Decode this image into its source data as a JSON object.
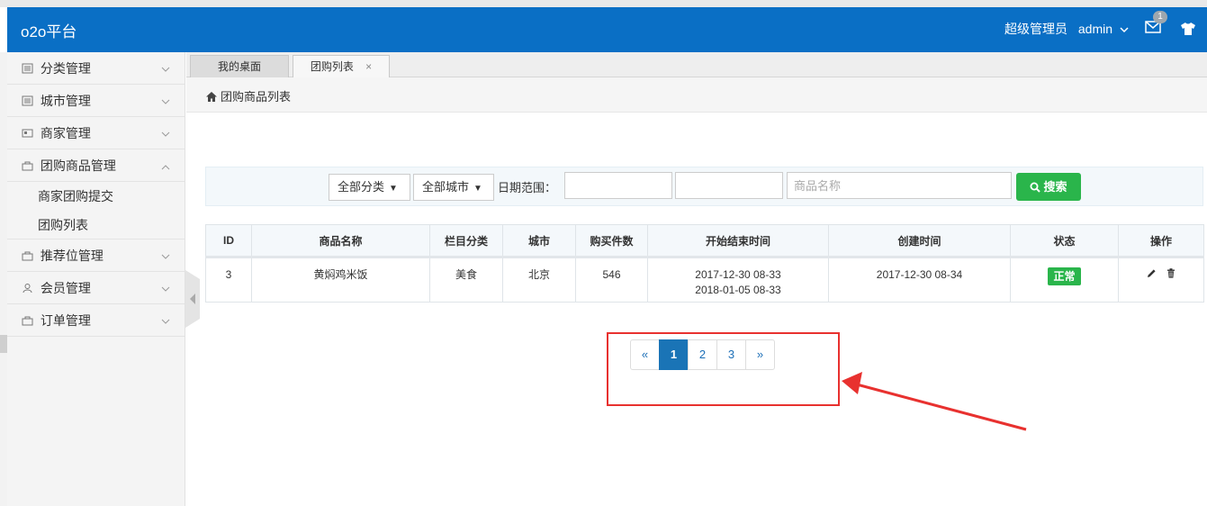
{
  "header": {
    "brand": "o2o平台",
    "role": "超级管理员",
    "user": "admin",
    "mail_count": "1"
  },
  "sidebar": {
    "items": [
      {
        "label": "分类管理"
      },
      {
        "label": "城市管理"
      },
      {
        "label": "商家管理"
      },
      {
        "label": "团购商品管理",
        "expanded": true,
        "children": [
          {
            "label": "商家团购提交"
          },
          {
            "label": "团购列表"
          }
        ]
      },
      {
        "label": "推荐位管理"
      },
      {
        "label": "会员管理"
      },
      {
        "label": "订单管理"
      }
    ]
  },
  "tabs": [
    {
      "label": "我的桌面"
    },
    {
      "label": "团购列表",
      "close": "×"
    }
  ],
  "breadcrumb": "团购商品列表",
  "search": {
    "category_select": "全部分类",
    "city_select": "全部城市",
    "date_label": "日期范围：",
    "date_start": "",
    "date_end": "",
    "name_placeholder": "商品名称",
    "button": "搜索"
  },
  "table": {
    "headers": [
      "ID",
      "商品名称",
      "栏目分类",
      "城市",
      "购买件数",
      "开始结束时间",
      "创建时间",
      "状态",
      "操作"
    ],
    "rows": [
      {
        "id": "3",
        "name": "黄焖鸡米饭",
        "category": "美食",
        "city": "北京",
        "bought": "546",
        "start": "2017-12-30 08-33",
        "end": "2018-01-05 08-33",
        "created": "2017-12-30 08-34",
        "status": "正常"
      }
    ]
  },
  "pagination": {
    "prev": "«",
    "pages": [
      "1",
      "2",
      "3"
    ],
    "current": "1",
    "next": "»"
  },
  "colors": {
    "header": "#0a6fc5",
    "success": "#2ab54b",
    "page_active": "#1a74b6",
    "annotation": "#e8312f"
  }
}
